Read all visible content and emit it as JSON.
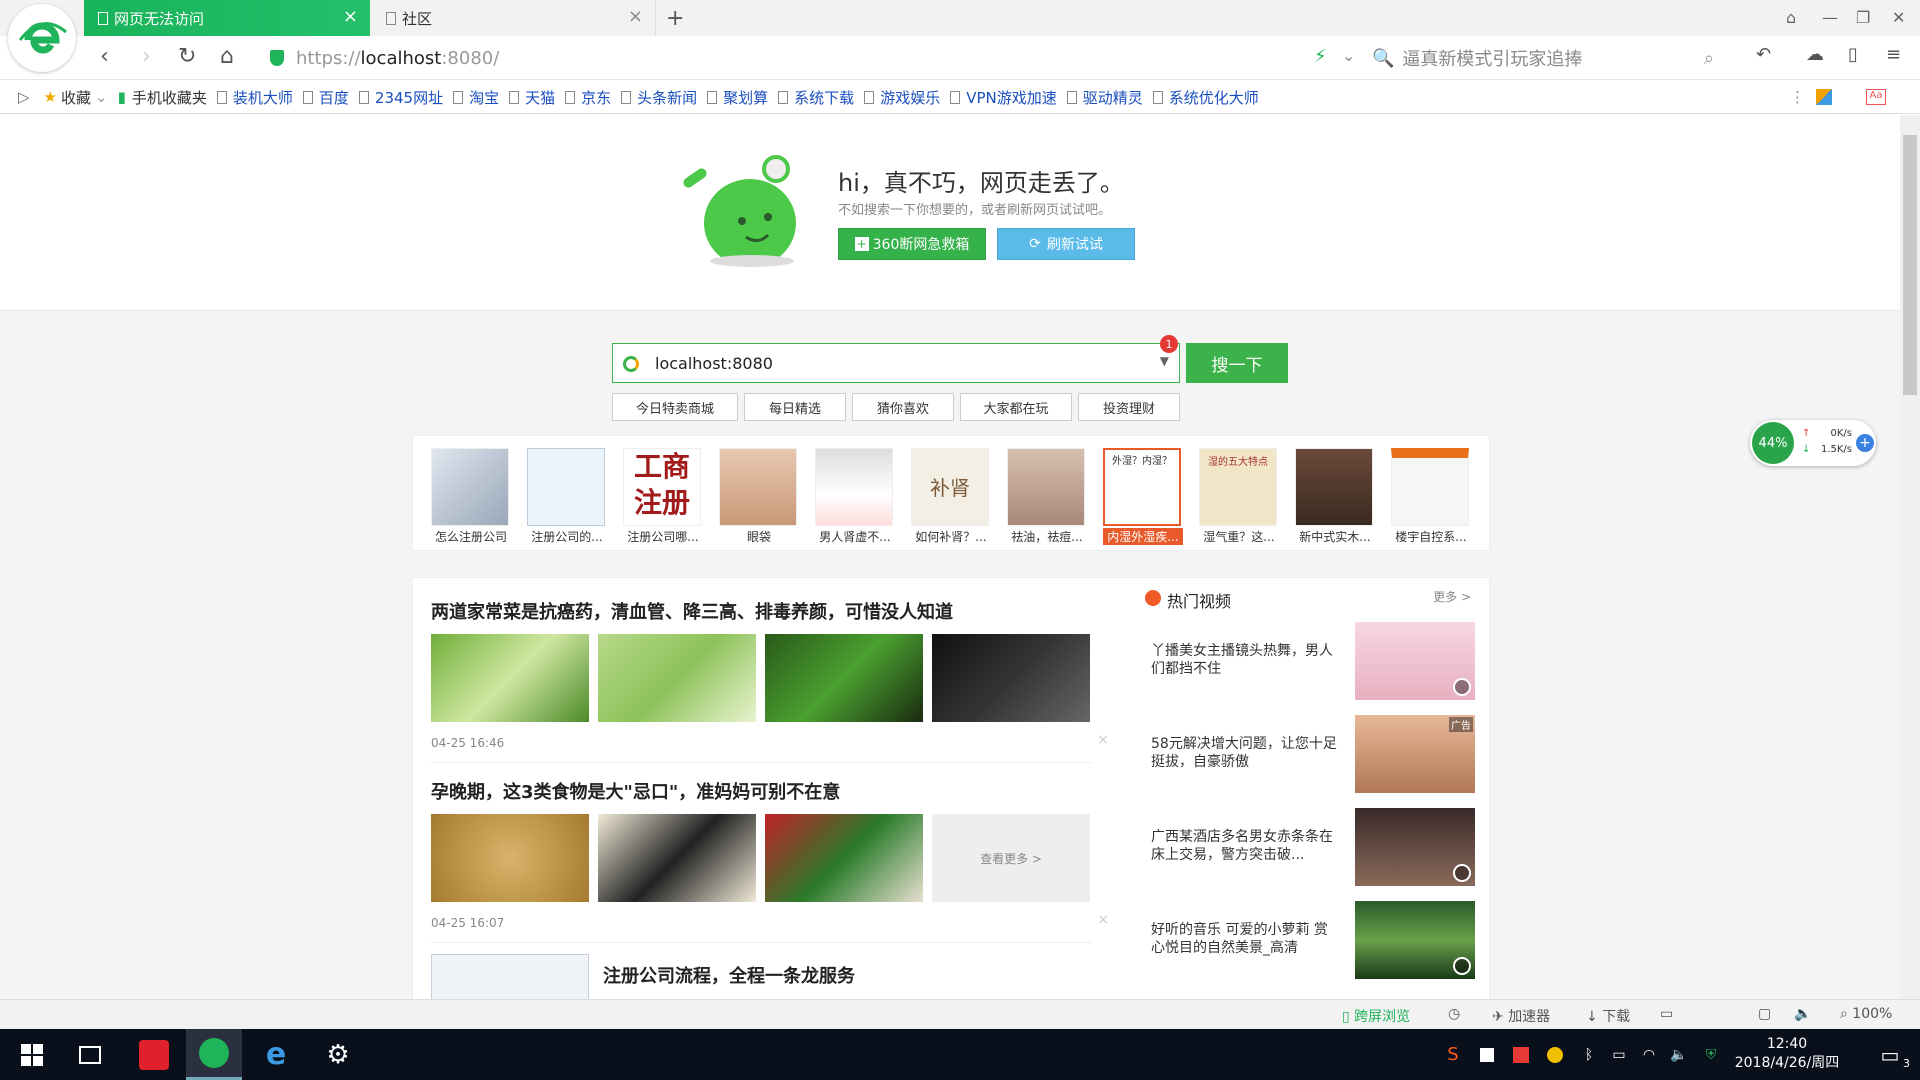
{
  "tabs": [
    {
      "label": "网页无法访问",
      "active": true
    },
    {
      "label": "社区",
      "active": false
    }
  ],
  "address": {
    "scheme": "https://",
    "host": "localhost",
    "port": ":8080/"
  },
  "search_hint": "逼真新模式引玩家追捧",
  "bookmarks": {
    "fav_label": "收藏",
    "mobile_label": "手机收藏夹",
    "items": [
      "装机大师",
      "百度",
      "2345网址",
      "淘宝",
      "天猫",
      "京东",
      "头条新闻",
      "聚划算",
      "系统下载",
      "游戏娱乐",
      "VPN游戏加速",
      "驱动精灵",
      "系统优化大师"
    ]
  },
  "error": {
    "title": "hi，真不巧，网页走丢了。",
    "subtitle": "不如搜索一下你想要的，或者刷新网页试试吧。",
    "fix_button": "360断网急救箱",
    "retry_button": "刷新试试"
  },
  "search": {
    "value": "localhost:8080",
    "button": "搜一下",
    "badge": "1"
  },
  "quick_links": [
    "今日特卖商城",
    "每日精选",
    "猜你喜欢",
    "大家都在玩",
    "投资理财"
  ],
  "ads": [
    "怎么注册公司",
    "注册公司的...",
    "注册公司哪...",
    "眼袋",
    "男人肾虚不...",
    "如何补肾？...",
    "祛油，祛痘...",
    "内湿外湿疾...",
    "湿气重？这...",
    "新中式实木...",
    "楼宇自控系..."
  ],
  "ad_texts": {
    "gongshang": "工商",
    "zhuce": "注册",
    "buchen": "补肾",
    "ad7_top": "外湿？内湿？",
    "ad9_top": "湿的五大特点"
  },
  "articles": [
    {
      "title": "两道家常菜是抗癌药，清血管、降三高、排毒养颜，可惜没人知道",
      "time": "04-25 16:46"
    },
    {
      "title": "孕晚期，这3类食物是大\"忌口\"，准妈妈可别不在意",
      "time": "04-25 16:07",
      "more": "查看更多 >"
    },
    {
      "title": "注册公司流程，全程一条龙服务",
      "time": ""
    }
  ],
  "hot_video": {
    "title": "热门视频",
    "more": "更多 >",
    "items": [
      {
        "text": "丫播美女主播镜头热舞，男人们都挡不住"
      },
      {
        "text": "58元解决增大问题，让您十足挺拔，自豪骄傲",
        "tag": "广告"
      },
      {
        "text": "广西某酒店多名男女赤条条在床上交易，警方突击破..."
      },
      {
        "text": "好听的音乐 可爱的小萝莉 赏心悦目的自然美景_高清"
      }
    ]
  },
  "net_widget": {
    "percent": "44%",
    "up": "0K/s",
    "down": "1.5K/s"
  },
  "status_bar": {
    "cross_screen": "跨屏浏览",
    "accelerator": "加速器",
    "download": "下载",
    "zoom": "100%"
  },
  "taskbar": {
    "time": "12:40",
    "date": "2018/4/26/周四",
    "notify_count": "3"
  },
  "colors": {
    "brand_green": "#3cb24a",
    "tab_green": "#19b35a",
    "retry_blue": "#5bbbe8",
    "taskbar": "#0a0f1c"
  }
}
